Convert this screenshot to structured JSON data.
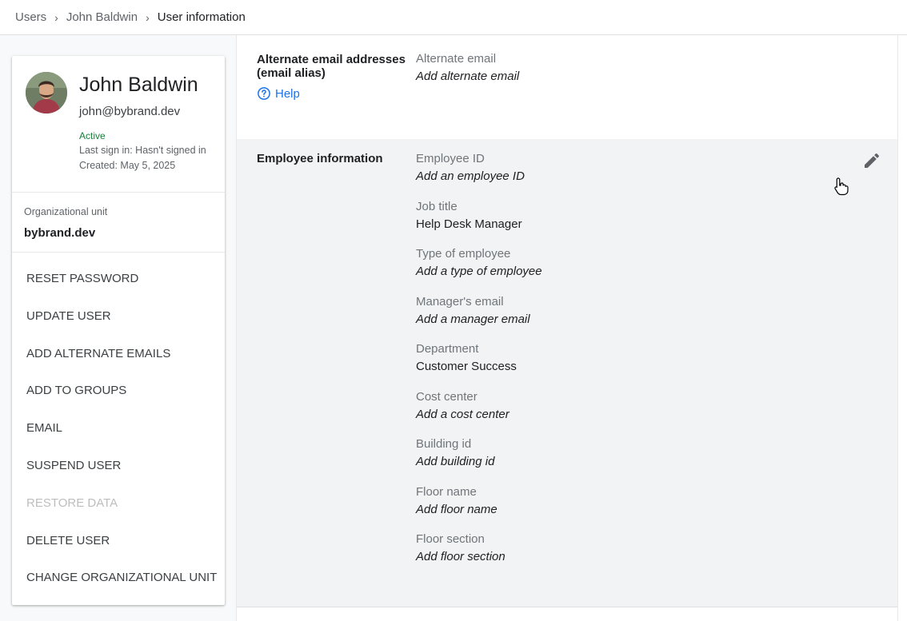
{
  "breadcrumb": {
    "items": [
      "Users",
      "John Baldwin",
      "User information"
    ]
  },
  "user": {
    "name": "John Baldwin",
    "email": "john@bybrand.dev",
    "status": "Active",
    "last_sign_in": "Last sign in: Hasn't signed in",
    "created": "Created: May 5, 2025"
  },
  "org": {
    "label": "Organizational unit",
    "value": "bybrand.dev"
  },
  "actions": [
    {
      "label": "RESET PASSWORD",
      "enabled": true
    },
    {
      "label": "UPDATE USER",
      "enabled": true
    },
    {
      "label": "ADD ALTERNATE EMAILS",
      "enabled": true
    },
    {
      "label": "ADD TO GROUPS",
      "enabled": true
    },
    {
      "label": "EMAIL",
      "enabled": true
    },
    {
      "label": "SUSPEND USER",
      "enabled": true
    },
    {
      "label": "RESTORE DATA",
      "enabled": false
    },
    {
      "label": "DELETE USER",
      "enabled": true
    },
    {
      "label": "CHANGE ORGANIZATIONAL UNIT",
      "enabled": true
    }
  ],
  "alias_section": {
    "title_line1": "Alternate email addresses",
    "title_line2": "(email alias)",
    "help_label": "Help",
    "field_label": "Alternate email",
    "field_value": "Add alternate email"
  },
  "employee_section": {
    "title": "Employee information",
    "fields": [
      {
        "label": "Employee ID",
        "value": "Add an employee ID",
        "placeholder": true
      },
      {
        "label": "Job title",
        "value": "Help Desk Manager",
        "placeholder": false
      },
      {
        "label": "Type of employee",
        "value": "Add a type of employee",
        "placeholder": true
      },
      {
        "label": "Manager's email",
        "value": "Add a manager email",
        "placeholder": true
      },
      {
        "label": "Department",
        "value": "Customer Success",
        "placeholder": false
      },
      {
        "label": "Cost center",
        "value": "Add a cost center",
        "placeholder": true
      },
      {
        "label": "Building id",
        "value": "Add building id",
        "placeholder": true
      },
      {
        "label": "Floor name",
        "value": "Add floor name",
        "placeholder": true
      },
      {
        "label": "Floor section",
        "value": "Add floor section",
        "placeholder": true
      }
    ]
  },
  "icons": {
    "help": "help-circle-icon",
    "edit": "pencil-icon",
    "cursor": "hand-pointer-icon",
    "breadcrumb_separator": "chevron-right-icon"
  },
  "colors": {
    "link": "#1a73e8",
    "active_status": "#188038",
    "section_highlight": "#f1f3f4",
    "disabled_text": "#bdbdbd"
  }
}
